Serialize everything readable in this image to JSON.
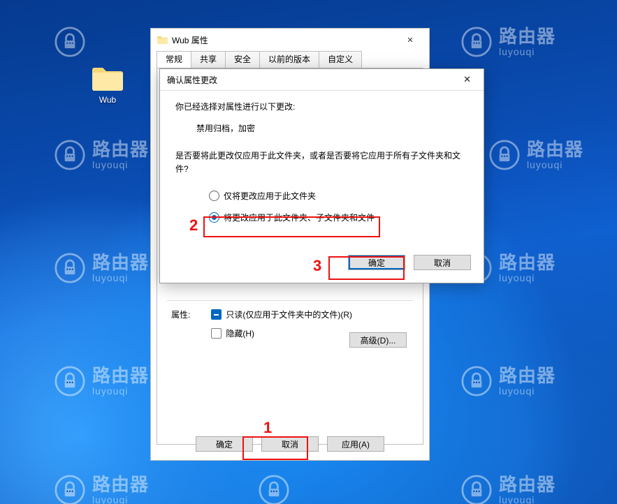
{
  "watermark": {
    "cn": "路由器",
    "en": "luyouqi"
  },
  "desktop": {
    "folder_label": "Wub"
  },
  "props_dialog": {
    "title": "Wub 属性",
    "tabs": [
      "常规",
      "共享",
      "安全",
      "以前的版本",
      "自定义"
    ],
    "attributes_label": "属性:",
    "readonly_label": "只读(仅应用于文件夹中的文件)(R)",
    "hidden_label": "隐藏(H)",
    "advanced": "高级(D)...",
    "ok": "确定",
    "cancel": "取消",
    "apply": "应用(A)"
  },
  "confirm_dialog": {
    "title": "确认属性更改",
    "heading": "你已经选择对属性进行以下更改:",
    "detail": "禁用归档，加密",
    "prompt": "是否要将此更改仅应用于此文件夹，或者是否要将它应用于所有子文件夹和文件?",
    "option1": "仅将更改应用于此文件夹",
    "option2": "将更改应用于此文件夹、子文件夹和文件",
    "ok": "确定",
    "cancel": "取消"
  },
  "annotations": {
    "n1": "1",
    "n2": "2",
    "n3": "3"
  }
}
